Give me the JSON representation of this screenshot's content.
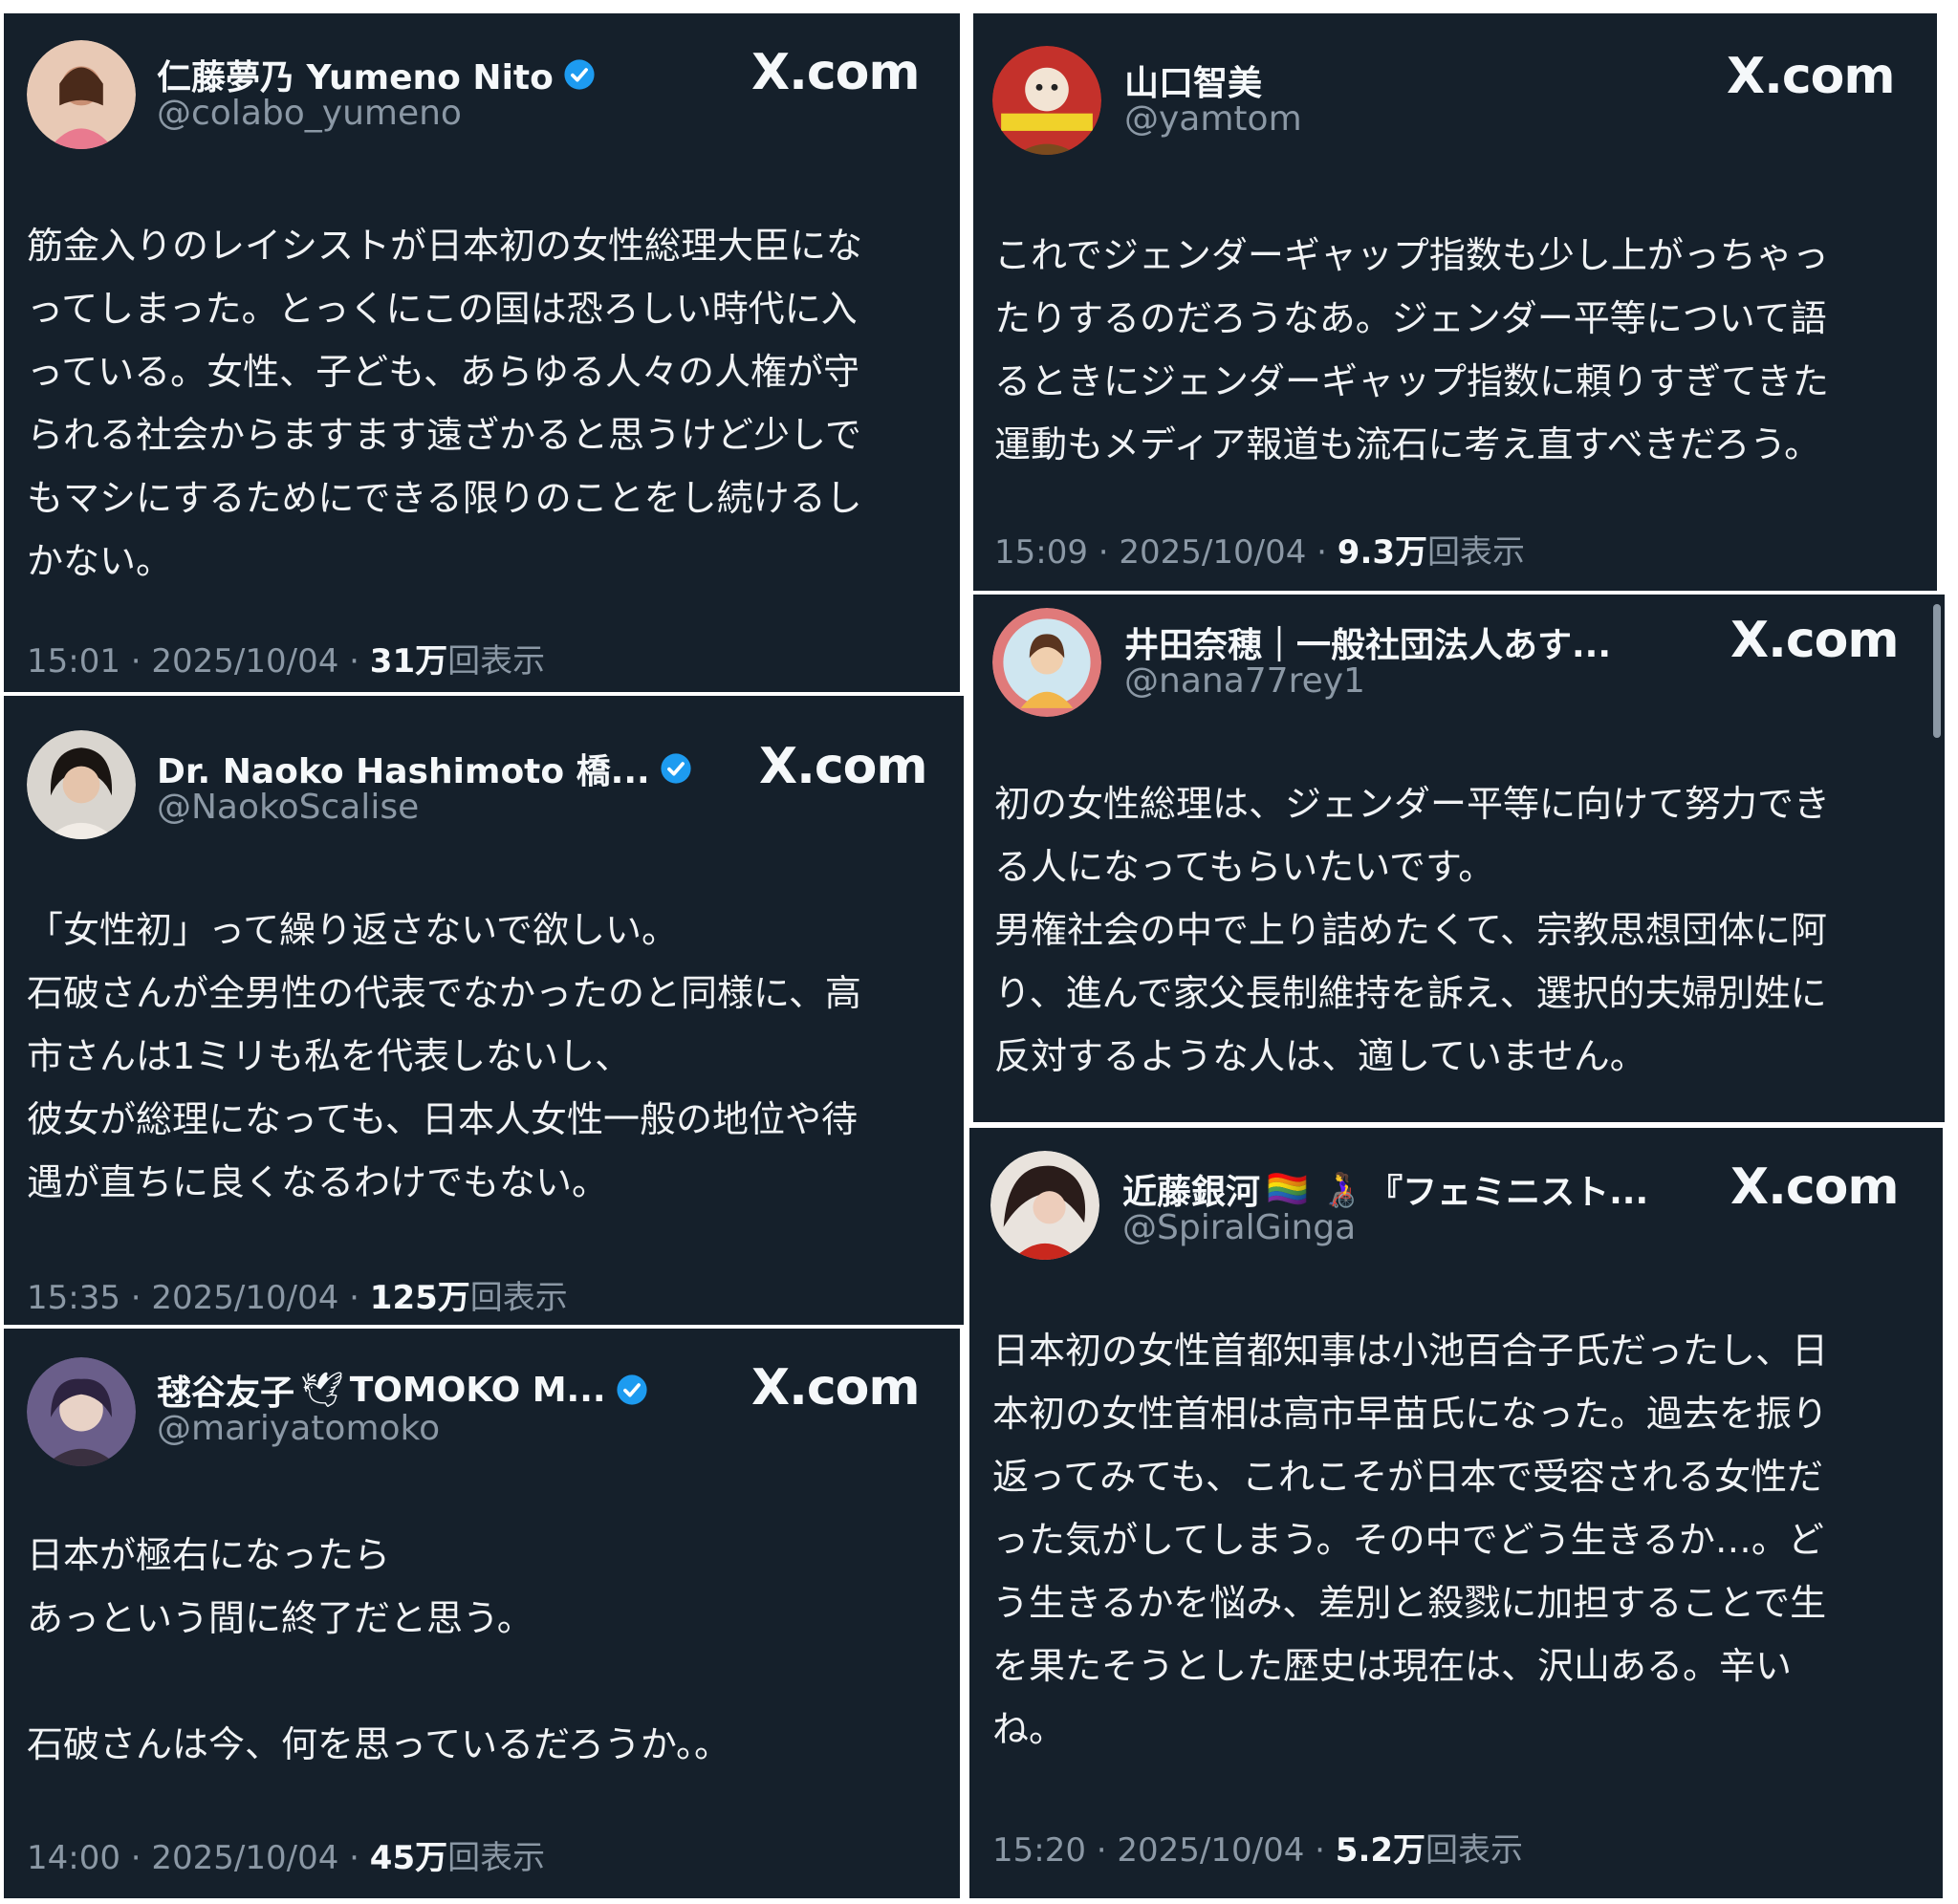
{
  "tweets": [
    {
      "display_name": "仁藤夢乃 Yumeno Nito",
      "handle": "@colabo_yumeno",
      "source": "X.com",
      "verified": true,
      "text": "筋金入りのレイシストが日本初の女性総理大臣にな\nってしまった。とっくにこの国は恐ろしい時代に入\nっている。女性、子ども、あらゆる人々の人権が守\nられる社会からますます遠ざかると思うけど少しで\nもマシにするためにできる限りのことをし続けるし\nかない。",
      "time": "15:01 · 2025/10/04 · ",
      "views": "31万",
      "views_suffix": "回表示"
    },
    {
      "display_name": "Dr. Naoko Hashimoto 橋...",
      "handle": "@NaokoScalise",
      "source": "X.com",
      "verified": true,
      "text": "「女性初」って繰り返さないで欲しい。\n石破さんが全男性の代表でなかったのと同様に、高\n市さんは1ミリも私を代表しないし、\n彼女が総理になっても、日本人女性一般の地位や待\n遇が直ちに良くなるわけでもない。",
      "time": "15:35 · 2025/10/04 · ",
      "views": "125万",
      "views_suffix": "回表示"
    },
    {
      "display_name_a": "毬谷友子",
      "emoji": "🕊",
      "display_name_b": "TOMOKO M...",
      "handle": "@mariyatomoko",
      "source": "X.com",
      "verified": true,
      "text": "日本が極右になったら\nあっという間に終了だと思う。\n\n石破さんは今、何を思っているだろうか。。",
      "time": "14:00 · 2025/10/04 · ",
      "views": "45万",
      "views_suffix": "回表示"
    },
    {
      "display_name": "山口智美",
      "handle": "@yamtom",
      "source": "X.com",
      "verified": false,
      "text": "これでジェンダーギャップ指数も少し上がっちゃっ\nたりするのだろうなあ。ジェンダー平等について語\nるときにジェンダーギャップ指数に頼りすぎてきた\n運動もメディア報道も流石に考え直すべきだろう。",
      "time": "15:09 · 2025/10/04 · ",
      "views": "9.3万",
      "views_suffix": "回表示"
    },
    {
      "display_name": "井田奈穂｜一般社団法人あす...",
      "handle": "@nana77rey1",
      "source": "X.com",
      "verified": false,
      "text": "初の女性総理は、ジェンダー平等に向けて努力でき\nる人になってもらいたいです。\n男権社会の中で上り詰めたくて、宗教思想団体に阿\nり、進んで家父長制維持を訴え、選択的夫婦別姓に\n反対するような人は、適していません。"
    },
    {
      "display_name_a": "近藤銀河",
      "emoji": "🏳️‍🌈 👩‍🦽",
      "display_name_b": "『フェミニスト...",
      "handle": "@SpiralGinga",
      "source": "X.com",
      "verified": false,
      "text": "日本初の女性首都知事は小池百合子氏だったし、日\n本初の女性首相は高市早苗氏になった。過去を振り\n返ってみても、これこそが日本で受容される女性だ\nった気がしてしまう。その中でどう生きるか…。ど\nう生きるかを悩み、差別と殺戮に加担することで生\nを果たそうとした歴史は現在は、沢山ある。辛い\nね。",
      "time": "15:20 · 2025/10/04 · ",
      "views": "5.2万",
      "views_suffix": "回表示"
    }
  ],
  "colors": {
    "card_bg": "#15202b",
    "text": "#f5f8fa",
    "muted": "#8b98a5",
    "verified": "#1d9bf0"
  }
}
